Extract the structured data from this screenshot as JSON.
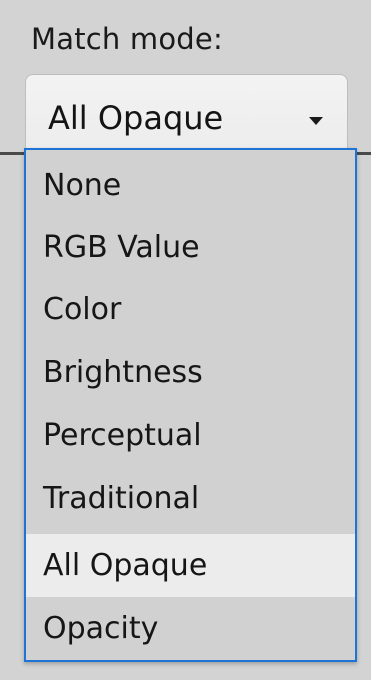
{
  "label": "Match mode:",
  "select": {
    "value": "All Opaque",
    "options": [
      "None",
      "RGB Value",
      "Color",
      "Brightness",
      "Perceptual",
      "Traditional",
      "All Opaque",
      "Opacity"
    ],
    "selected": "All Opaque"
  },
  "colors": {
    "dropdown_border": "#1e74d6",
    "selected_bg": "#ececec",
    "background": "#d3d3d3"
  },
  "icons": {
    "caret": "chevron-down-icon"
  }
}
